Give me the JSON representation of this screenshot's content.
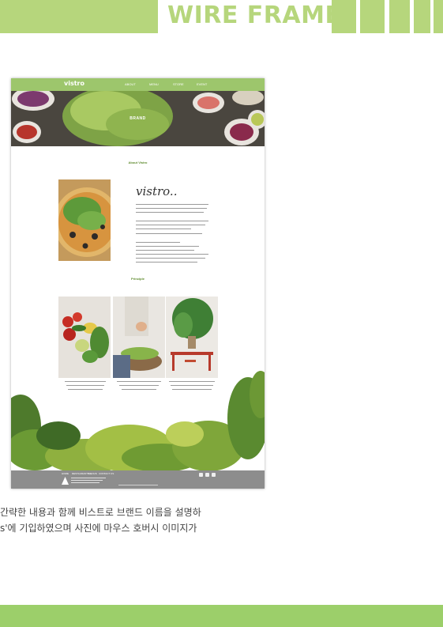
{
  "header": {
    "title": "WIRE FRAME",
    "accent_color": "#b6d67c"
  },
  "mockup": {
    "logo": "vistro",
    "nav": [
      "ABOUT",
      "MENU",
      "STORE",
      "EVENT"
    ],
    "hero_label": "BRAND",
    "about_title": "About Vistro",
    "brand_script": "vistro..",
    "principle_title": "Principle",
    "footer_links": [
      "HOME",
      "RESTAURANTS",
      "MENUS",
      "CONTACT US"
    ]
  },
  "description": {
    "line1": "간략한 내용과 함께 비스트로 브랜드 이름을 설명하",
    "line2": "s'에 기입하였으며 사진에 마우스 호버시 이미지가"
  },
  "footer_bar": {
    "color": "#9ccf6a"
  }
}
